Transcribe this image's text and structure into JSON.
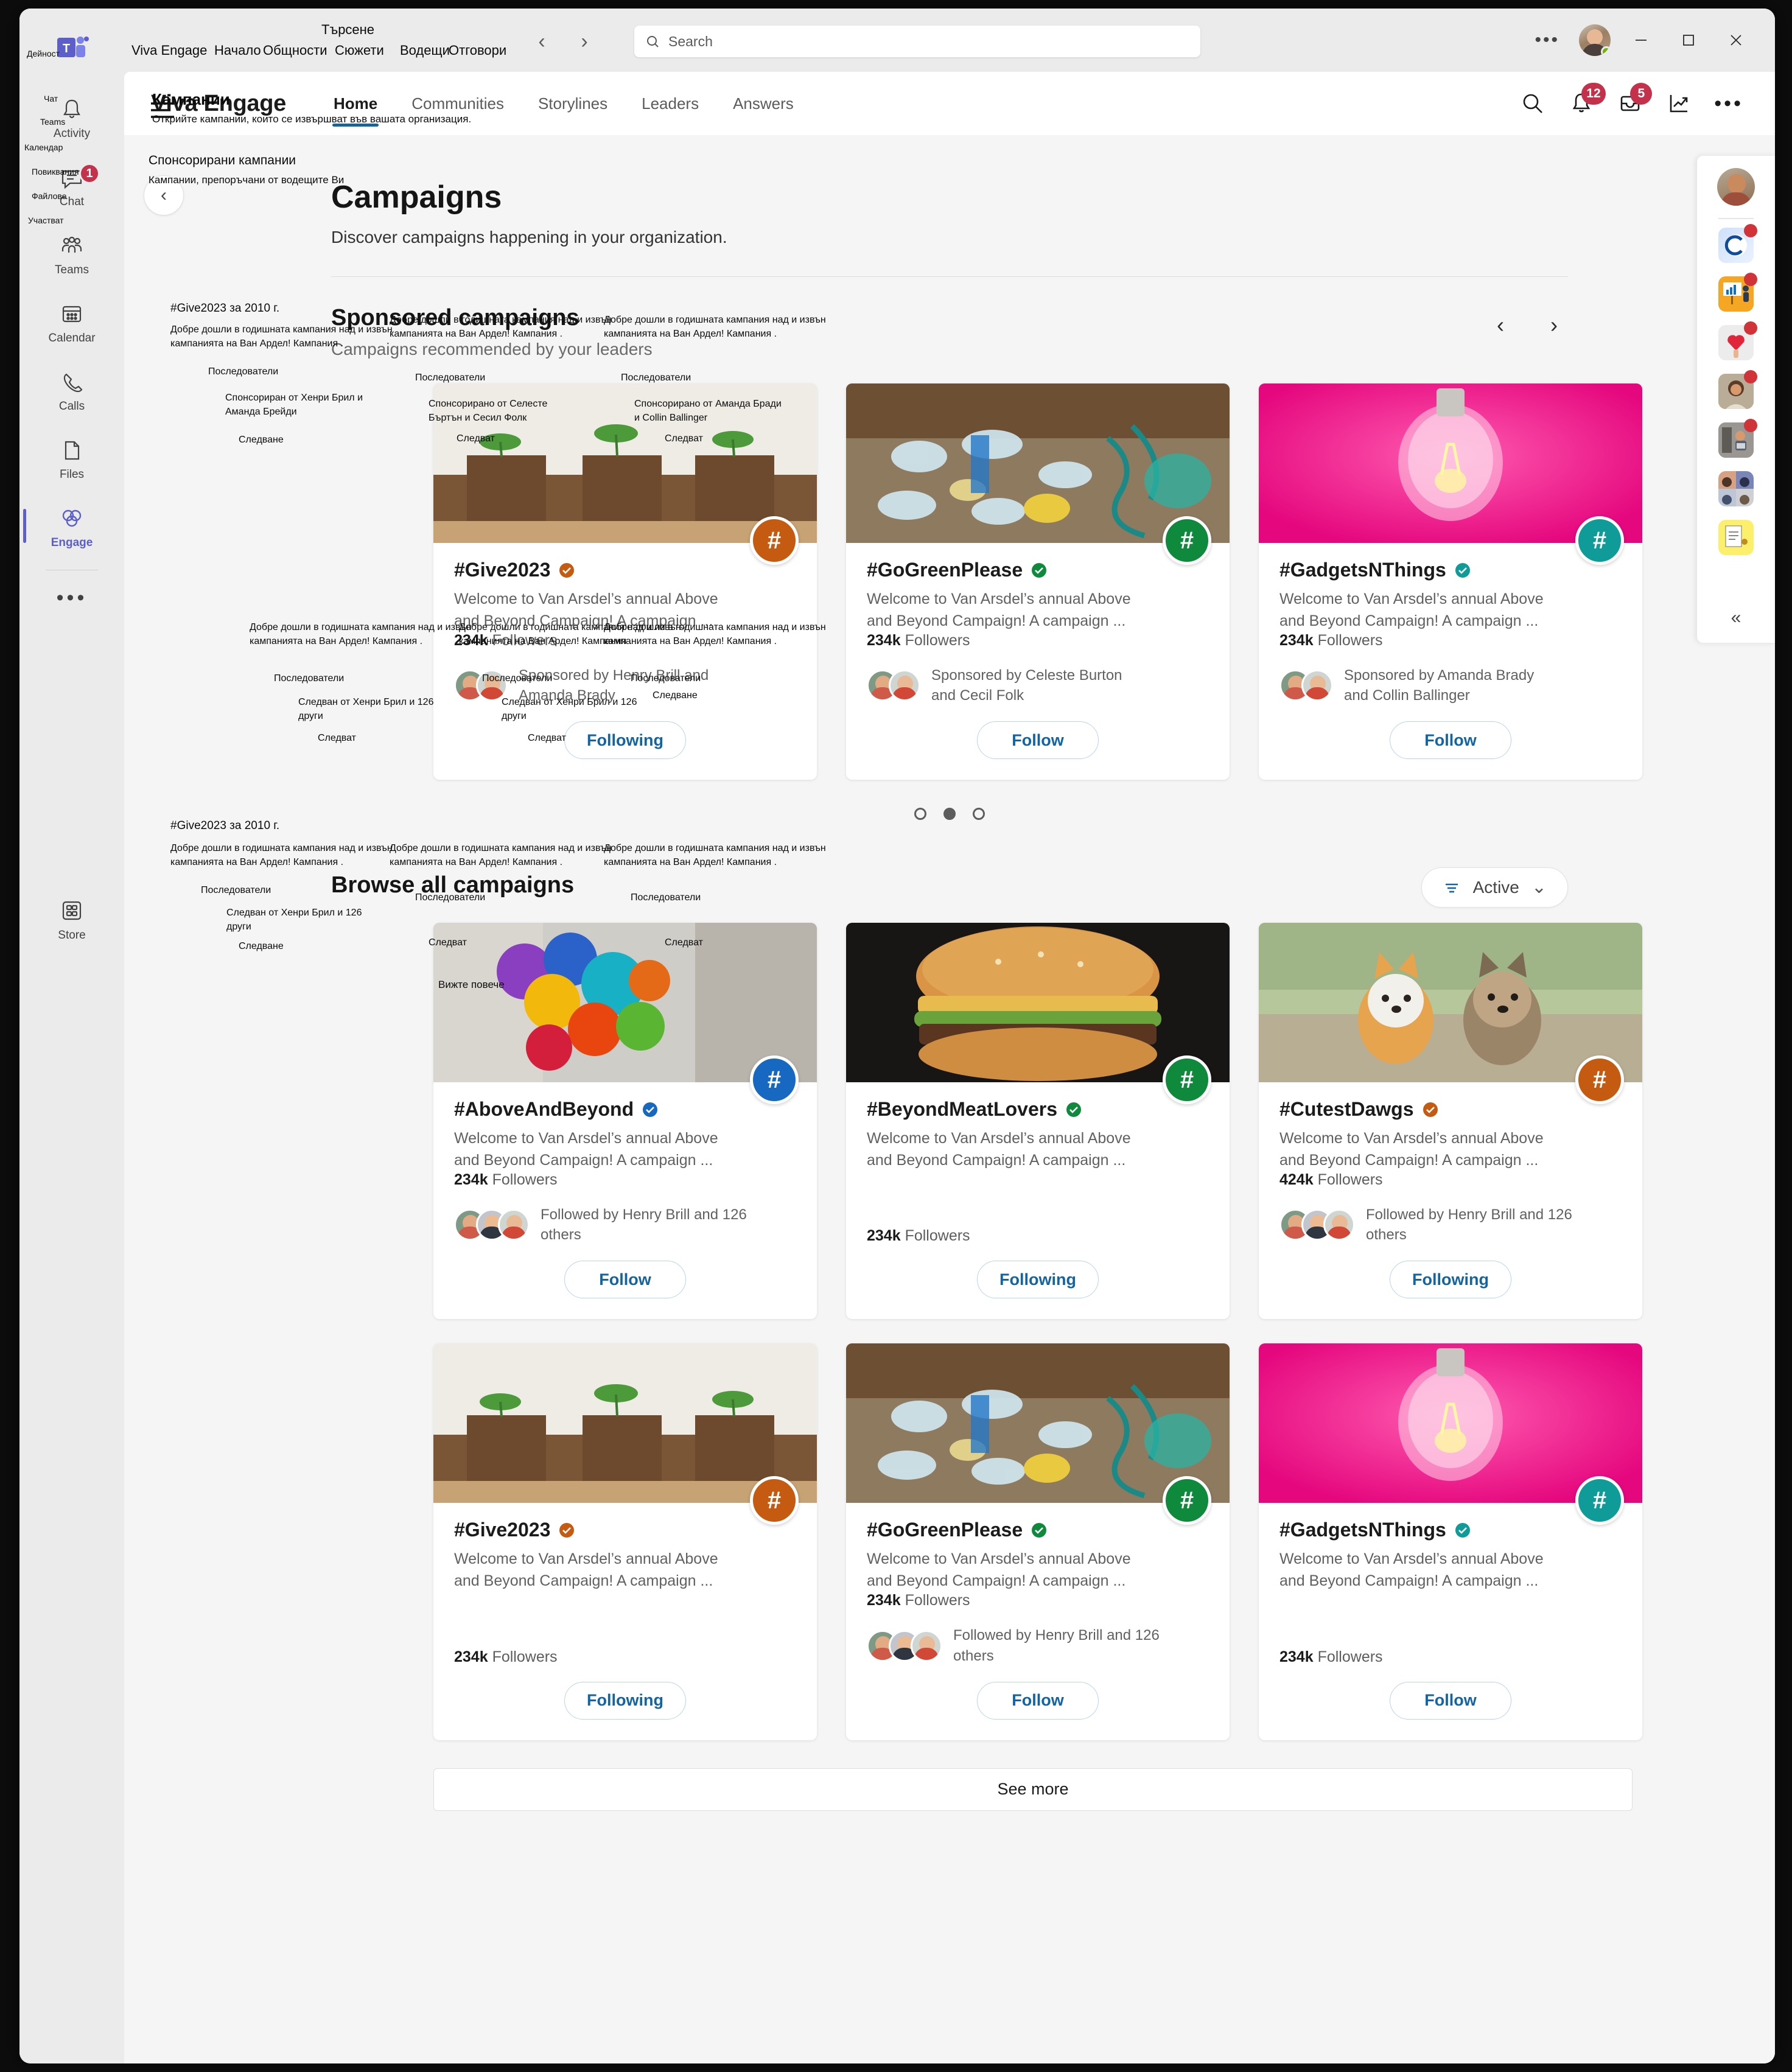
{
  "titlebar": {
    "search_placeholder": "Search",
    "overlay_search_label": "Търсене",
    "back_label": "‹",
    "forward_label": "›",
    "more_dots": "•••",
    "minimize": "–",
    "maximize": "□",
    "close": "✕"
  },
  "rail": {
    "items": [
      {
        "label": "Activity",
        "overlay": "Дейност",
        "icon": "bell-icon",
        "badge": "",
        "active": false
      },
      {
        "label": "Chat",
        "overlay": "Чат",
        "icon": "chat-icon",
        "badge": "1",
        "active": false
      },
      {
        "label": "Teams",
        "overlay": "Teams",
        "icon": "teams-icon",
        "badge": "",
        "active": false
      },
      {
        "label": "Calendar",
        "overlay": "Календар",
        "icon": "calendar-icon",
        "badge": "",
        "active": false
      },
      {
        "label": "Calls",
        "overlay": "Повиквания",
        "icon": "phone-icon",
        "badge": "",
        "active": false
      },
      {
        "label": "Files",
        "overlay": "Файлове",
        "icon": "file-icon",
        "badge": "",
        "active": false
      },
      {
        "label": "Engage",
        "overlay": "Участват",
        "icon": "engage-icon",
        "badge": "",
        "active": true
      }
    ],
    "more": "•••",
    "store_label": "Store"
  },
  "header": {
    "brand": "Viva Engage",
    "overlay_brand": "Viva Engage",
    "hamburger_overlay_title": "Кампании",
    "hamburger_overlay_sub": "Открийте кампании, които се извършват във вашата организация.",
    "nav": [
      {
        "label": "Home",
        "overlay": "Начало",
        "active": true
      },
      {
        "label": "Communities",
        "overlay": "Общности",
        "active": false
      },
      {
        "label": "Storylines",
        "overlay": "Сюжети",
        "active": false
      },
      {
        "label": "Leaders",
        "overlay": "Водещи",
        "active": false
      },
      {
        "label": "Answers",
        "overlay": "Отговори",
        "active": false
      }
    ],
    "icons": [
      {
        "name": "search-icon",
        "badge": ""
      },
      {
        "name": "bell-icon",
        "badge": "12"
      },
      {
        "name": "inbox-icon",
        "badge": "5"
      },
      {
        "name": "analytics-icon",
        "badge": ""
      }
    ],
    "more_dots": "•••"
  },
  "page": {
    "title": "Campaigns",
    "subtitle": "Discover campaigns happening in your organization."
  },
  "sponsored": {
    "title": "Sponsored campaigns",
    "subtitle": "Campaigns recommended by your leaders",
    "overlay_title": "Спонсорирани кампании",
    "overlay_subtitle": "Кампании, препоръчани от водещите Ви",
    "prev": "‹",
    "next": "›",
    "dots": [
      false,
      true,
      false
    ],
    "cards": [
      {
        "title": "#Give2023",
        "desc": "Welcome to Van Arsdel’s annual Above and Beyond Campaign! A campaign ...",
        "followers_count": "234k",
        "followers_label": "Followers",
        "people_text": "Sponsored by Henry Brill and Amanda Brady",
        "button": "Following",
        "badge_color": "#c55a11",
        "verified_color": "#c55a11",
        "image": "seedlings",
        "show_faces": true,
        "face_count": 2
      },
      {
        "title": "#GoGreenPlease",
        "desc": "Welcome to Van Arsdel’s annual Above and Beyond Campaign! A campaign ...",
        "followers_count": "234k",
        "followers_label": "Followers",
        "people_text": "Sponsored by Celeste Burton and Cecil Folk",
        "button": "Follow",
        "badge_color": "#0f8a3c",
        "verified_color": "#0f8a3c",
        "image": "plastic",
        "show_faces": true,
        "face_count": 2
      },
      {
        "title": "#GadgetsNThings",
        "desc": "Welcome to Van Arsdel’s annual Above and Beyond Campaign! A campaign ...",
        "followers_count": "234k",
        "followers_label": "Followers",
        "people_text": "Sponsored by Amanda Brady and Collin Ballinger",
        "button": "Follow",
        "badge_color": "#0f9b97",
        "verified_color": "#0f9b97",
        "image": "bulb",
        "show_faces": true,
        "face_count": 2
      }
    ]
  },
  "browse": {
    "title": "Browse all campaigns",
    "overlay_title_extra": "Вижте повече",
    "filter_label": "Active",
    "filter_chevron": "⌄",
    "see_more": "See more",
    "cards": [
      {
        "title": "#AboveAndBeyond",
        "desc": "Welcome to Van Arsdel’s annual Above and Beyond Campaign! A campaign ...",
        "followers_count": "234k",
        "followers_label": "Followers",
        "people_text": "Followed by Henry Brill and 126 others",
        "button": "Follow",
        "badge_color": "#1668c1",
        "verified_color": "#1668c1",
        "image": "balloons",
        "show_faces": true,
        "face_count": 3
      },
      {
        "title": "#BeyondMeatLovers",
        "desc": "Welcome to Van Arsdel’s annual Above and Beyond Campaign! A campaign ...",
        "followers_count": "234k",
        "followers_label": "Followers",
        "people_text": "",
        "button": "Following",
        "badge_color": "#0f8a3c",
        "verified_color": "#0f8a3c",
        "image": "burger",
        "show_faces": false,
        "face_count": 0
      },
      {
        "title": "#CutestDawgs",
        "desc": "Welcome to Van Arsdel’s annual Above and Beyond Campaign! A campaign ...",
        "followers_count": "424k",
        "followers_label": "Followers",
        "people_text": "Followed by Henry Brill and 126 others",
        "button": "Following",
        "badge_color": "#c55a11",
        "verified_color": "#c55a11",
        "image": "dogs",
        "show_faces": true,
        "face_count": 3
      },
      {
        "title": "#Give2023",
        "desc": "Welcome to Van Arsdel’s annual Above and Beyond Campaign! A campaign ...",
        "followers_count": "234k",
        "followers_label": "Followers",
        "people_text": "",
        "button": "Following",
        "badge_color": "#c55a11",
        "verified_color": "#c55a11",
        "image": "seedlings",
        "show_faces": false,
        "face_count": 0
      },
      {
        "title": "#GoGreenPlease",
        "desc": "Welcome to Van Arsdel’s annual Above and Beyond Campaign! A campaign ...",
        "followers_count": "234k",
        "followers_label": "Followers",
        "people_text": "Followed by Henry Brill and 126 others",
        "button": "Follow",
        "badge_color": "#0f8a3c",
        "verified_color": "#0f8a3c",
        "image": "plastic",
        "show_faces": true,
        "face_count": 3
      },
      {
        "title": "#GadgetsNThings",
        "desc": "Welcome to Van Arsdel’s annual Above and Beyond Campaign! A campaign ...",
        "followers_count": "234k",
        "followers_label": "Followers",
        "people_text": "",
        "button": "Follow",
        "badge_color": "#0f9b97",
        "verified_color": "#0f9b97",
        "image": "bulb",
        "show_faces": false,
        "face_count": 0
      }
    ]
  },
  "translation_overlay": {
    "give2023_heading": "#Give2023 за 2010 г.",
    "desc": "Добре дошли в годишната кампания над и извън кампанията на Ван Ардел! Кампания .",
    "followers": "Последователи",
    "sponsored_hb_ab": "Спонсориран от Хенри Брил и Аманда Брейди",
    "sponsored_cb_cf": "Спонсорирано от Селесте Бъртън и Сесил Фолк",
    "sponsored_ab_cb": "Спонсорирано от Аманда Бради и Collin Ballinger",
    "followed_by": "Следван от Хенри Брил и 126 други",
    "follow_verb": "Следване",
    "follow_plural": "Следват",
    "campaigns_word": "Кампания"
  },
  "flyout": {
    "apps": [
      {
        "name": "app-c-icon",
        "dot": true
      },
      {
        "name": "app-chart-icon",
        "dot": true
      },
      {
        "name": "app-heart-icon",
        "dot": true
      },
      {
        "name": "app-person-icon",
        "dot": true
      },
      {
        "name": "app-laptop-icon",
        "dot": true
      },
      {
        "name": "app-grid-people-icon",
        "dot": false
      },
      {
        "name": "app-document-icon",
        "dot": false
      }
    ],
    "collapse": "«"
  }
}
